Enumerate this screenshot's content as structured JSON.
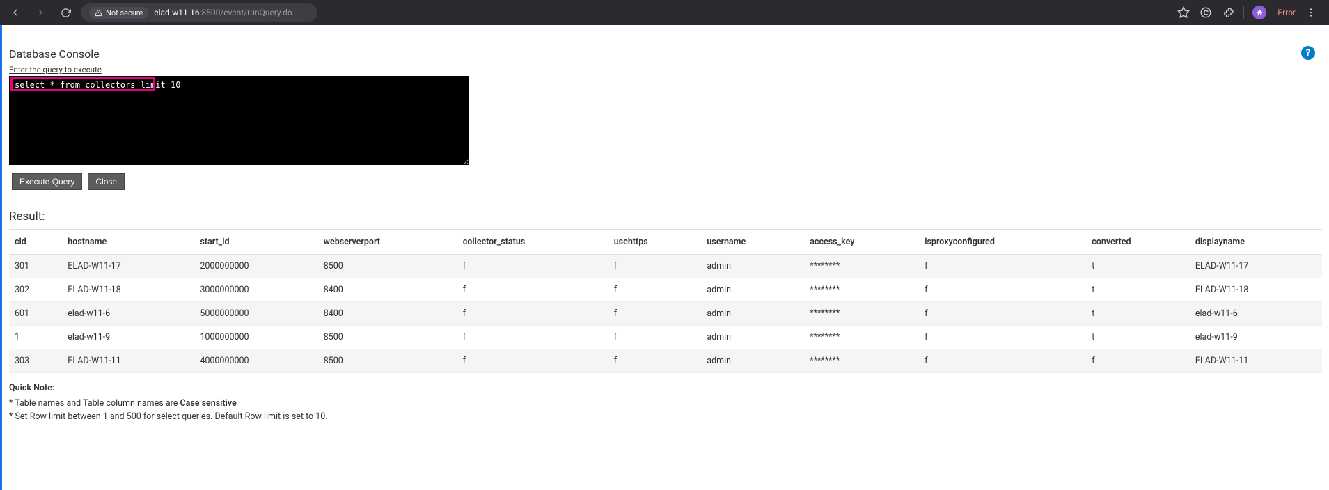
{
  "chrome": {
    "not_secure": "Not secure",
    "url_host": "elad-w11-16",
    "url_port_path": ":8500/event/runQuery.do",
    "error_label": "Error"
  },
  "page": {
    "title": "Database Console",
    "query_label": "Enter the query to execute",
    "query_value": "select * from collectors limit 10",
    "execute_btn": "Execute Query",
    "close_btn": "Close",
    "result_heading": "Result:",
    "help_symbol": "?"
  },
  "table": {
    "headers": [
      "cid",
      "hostname",
      "start_id",
      "webserverport",
      "collector_status",
      "usehttps",
      "username",
      "access_key",
      "isproxyconfigured",
      "converted",
      "displayname"
    ],
    "rows": [
      [
        "301",
        "ELAD-W11-17",
        "2000000000",
        "8500",
        "f",
        "f",
        "admin",
        "********",
        "f",
        "t",
        "ELAD-W11-17"
      ],
      [
        "302",
        "ELAD-W11-18",
        "3000000000",
        "8400",
        "f",
        "f",
        "admin",
        "********",
        "f",
        "t",
        "ELAD-W11-18"
      ],
      [
        "601",
        "elad-w11-6",
        "5000000000",
        "8400",
        "f",
        "f",
        "admin",
        "********",
        "f",
        "t",
        "elad-w11-6"
      ],
      [
        "1",
        "elad-w11-9",
        "1000000000",
        "8500",
        "f",
        "f",
        "admin",
        "********",
        "f",
        "t",
        "elad-w11-9"
      ],
      [
        "303",
        "ELAD-W11-11",
        "4000000000",
        "8500",
        "f",
        "f",
        "admin",
        "********",
        "f",
        "f",
        "ELAD-W11-11"
      ]
    ]
  },
  "notes": {
    "heading": "Quick Note:",
    "line1_prefix": "* Table names and Table column names are ",
    "line1_bold": "Case sensitive",
    "line2": "* Set Row limit between 1 and 500 for select queries. Default Row limit is set to 10."
  }
}
